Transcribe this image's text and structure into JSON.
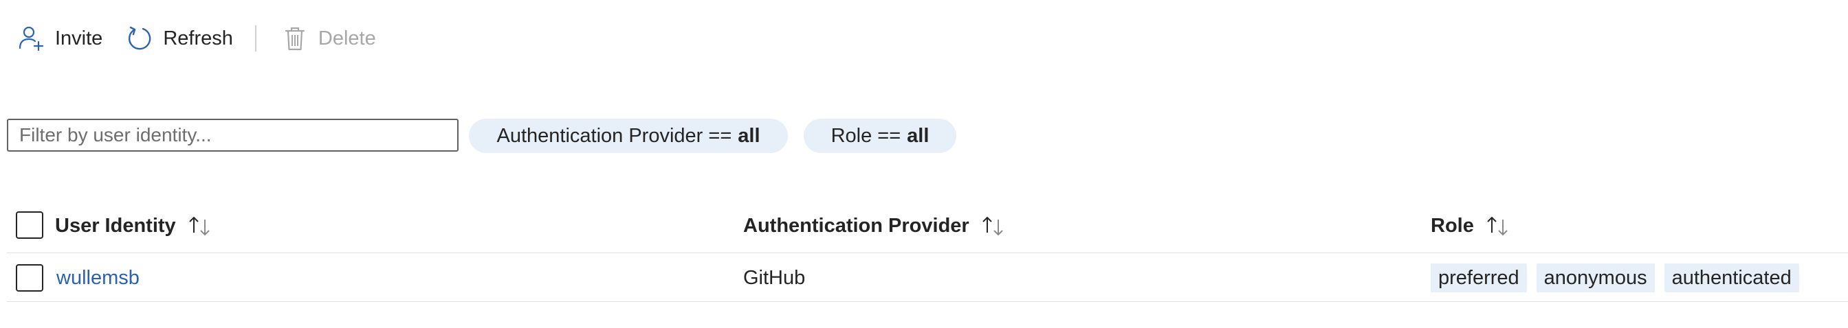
{
  "toolbar": {
    "invite_label": "Invite",
    "refresh_label": "Refresh",
    "delete_label": "Delete"
  },
  "filter": {
    "placeholder": "Filter by user identity...",
    "value": ""
  },
  "pills": {
    "auth_provider": {
      "field": "Authentication Provider ==",
      "value": "all"
    },
    "role": {
      "field": "Role ==",
      "value": "all"
    }
  },
  "table": {
    "columns": {
      "user_identity": "User Identity",
      "auth_provider": "Authentication Provider",
      "role": "Role"
    },
    "rows": [
      {
        "user_identity": "wullemsb",
        "auth_provider": "GitHub",
        "roles": [
          "preferred",
          "anonymous",
          "authenticated"
        ]
      }
    ]
  },
  "colors": {
    "accent": "#2a62b3",
    "pill_bg": "#e7eff9",
    "disabled_text": "#a7a7a7"
  }
}
